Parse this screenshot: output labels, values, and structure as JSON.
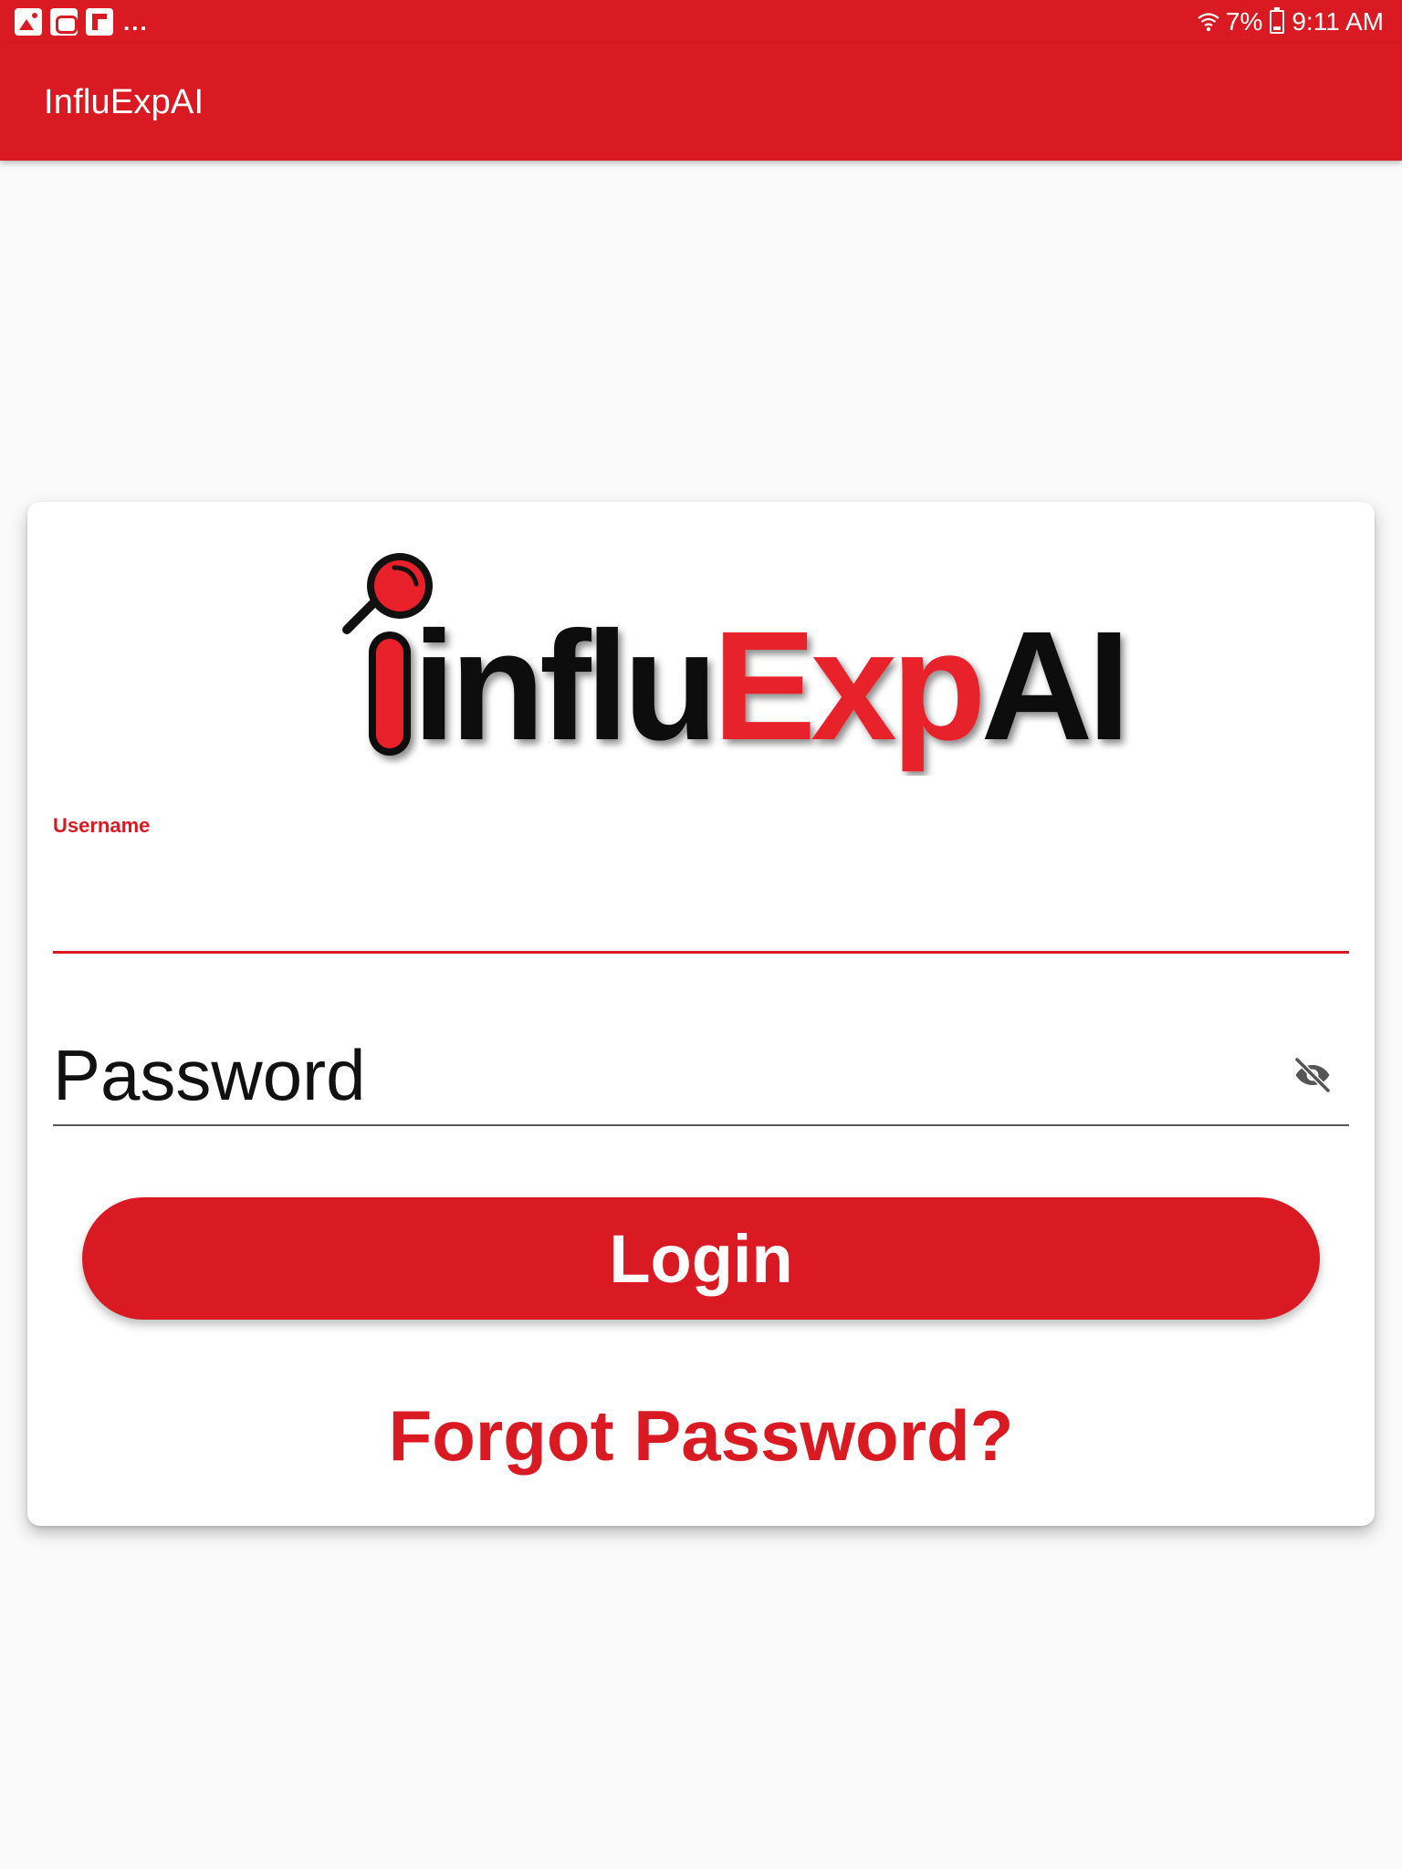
{
  "status_bar": {
    "notification_icons": [
      "gallery-icon",
      "mail-icon",
      "flipboard-icon"
    ],
    "more": "...",
    "battery": "7%",
    "time": "9:11 AM"
  },
  "app_bar": {
    "title": "InfluExpAI"
  },
  "logo": {
    "part_black_1": "influ",
    "part_red": "Exp",
    "part_black_2": "AI"
  },
  "form": {
    "username_label": "Username",
    "username_value": "",
    "password_placeholder": "Password",
    "password_value": "",
    "login_label": "Login",
    "forgot_label": "Forgot Password?"
  },
  "colors": {
    "accent": "#da1a22",
    "background": "#fafafa",
    "card": "#ffffff"
  }
}
